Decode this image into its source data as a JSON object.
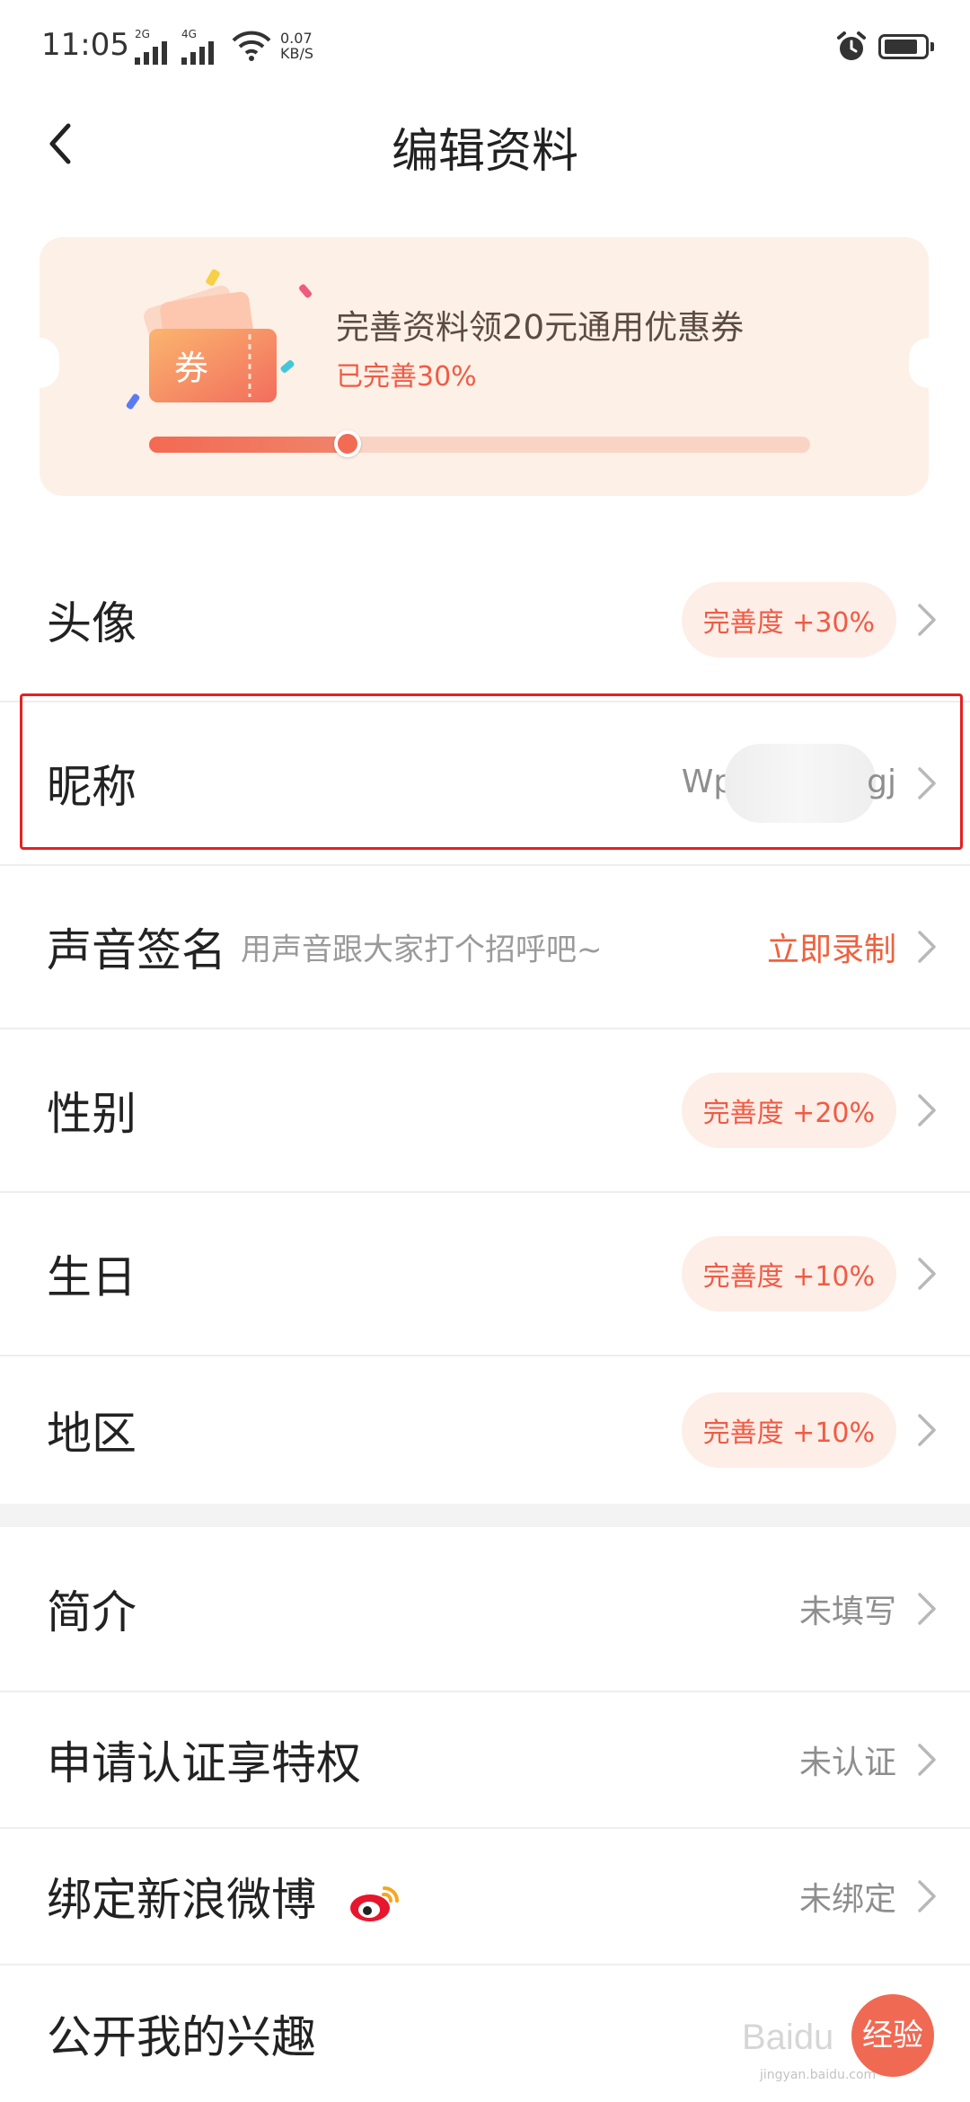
{
  "status_bar": {
    "time": "11:05",
    "net1": "2G",
    "net2": "4G",
    "speed_value": "0.07",
    "speed_unit": "KB/S"
  },
  "header": {
    "title": "编辑资料"
  },
  "banner": {
    "ticket_text": "券",
    "title": "完善资料领20元通用优惠券",
    "progress_text": "已完善30%",
    "progress": 0.3
  },
  "rows": [
    {
      "label": "头像",
      "pill": "完善度 +30%"
    },
    {
      "label": "昵称",
      "value_prefix": "Wp",
      "value_suffix": "gj"
    },
    {
      "label": "声音签名",
      "hint": "用声音跟大家打个招呼吧~",
      "action": "立即录制"
    },
    {
      "label": "性别",
      "pill": "完善度 +20%"
    },
    {
      "label": "生日",
      "pill": "完善度 +10%"
    },
    {
      "label": "地区",
      "pill": "完善度 +10%"
    },
    {
      "label": "简介",
      "value": "未填写"
    },
    {
      "label": "申请认证享特权",
      "value": "未认证"
    },
    {
      "label": "绑定新浪微博",
      "value": "未绑定"
    },
    {
      "label": "公开我的兴趣"
    }
  ],
  "watermark": {
    "text": "Baidu",
    "badge": "经验",
    "sub": "jingyan.baidu.com"
  },
  "colors": {
    "accent": "#f05b45",
    "banner_bg": "#fdf0e6",
    "highlight_border": "#e62020"
  }
}
